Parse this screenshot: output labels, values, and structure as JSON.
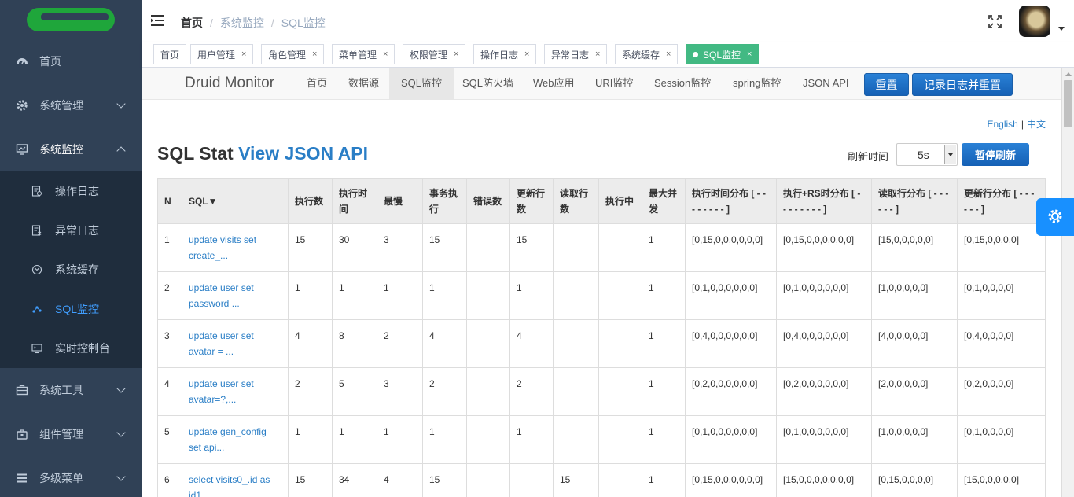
{
  "sidebar": {
    "items": [
      {
        "label": "首页",
        "icon": "dashboard-icon"
      },
      {
        "label": "系统管理",
        "icon": "gear-icon"
      },
      {
        "label": "系统监控",
        "icon": "monitor-icon"
      },
      {
        "label": "系统工具",
        "icon": "toolbox-icon"
      },
      {
        "label": "组件管理",
        "icon": "component-icon"
      },
      {
        "label": "多级菜单",
        "icon": "list-icon"
      }
    ],
    "submenu": [
      {
        "label": "操作日志",
        "icon": "log-icon"
      },
      {
        "label": "异常日志",
        "icon": "error-log-icon"
      },
      {
        "label": "系统缓存",
        "icon": "cache-icon"
      },
      {
        "label": "SQL监控",
        "icon": "sql-icon"
      },
      {
        "label": "实时控制台",
        "icon": "console-icon"
      }
    ],
    "active_color": "#409eff"
  },
  "navbar": {
    "breadcrumb": [
      "首页",
      "系统监控",
      "SQL监控"
    ]
  },
  "tags": [
    {
      "label": "首页"
    },
    {
      "label": "用户管理"
    },
    {
      "label": "角色管理"
    },
    {
      "label": "菜单管理"
    },
    {
      "label": "权限管理"
    },
    {
      "label": "操作日志"
    },
    {
      "label": "异常日志"
    },
    {
      "label": "系统缓存"
    },
    {
      "label": "SQL监控"
    }
  ],
  "druid": {
    "brand": "Druid Monitor",
    "nav": [
      "首页",
      "数据源",
      "SQL监控",
      "SQL防火墙",
      "Web应用",
      "URI监控",
      "Session监控",
      "spring监控",
      "JSON API"
    ],
    "reset_label": "重置",
    "log_reset_label": "记录日志并重置",
    "lang_en": "English",
    "lang_sep": "|",
    "lang_zh": "中文",
    "title": "SQL Stat",
    "title_link": "View JSON API",
    "refresh_label": "刷新时间",
    "refresh_value": "5s",
    "pause_label": "暂停刷新"
  },
  "table": {
    "headers": [
      "N",
      "SQL▼",
      "执行数",
      "执行时间",
      "最慢",
      "事务执行",
      "错误数",
      "更新行数",
      "读取行数",
      "执行中",
      "最大并发",
      "执行时间分布 [ - - - - - - - - ]",
      "执行+RS时分布 [ - - - - - - - - ]",
      "读取行分布 [ - - - - - - ]",
      "更新行分布 [ - - - - - - ]"
    ],
    "rows": [
      [
        "1",
        "update visits set create_...",
        "15",
        "30",
        "3",
        "15",
        "",
        "15",
        "",
        "",
        "1",
        "[0,15,0,0,0,0,0,0]",
        "[0,15,0,0,0,0,0,0]",
        "[15,0,0,0,0,0]",
        "[0,15,0,0,0,0]"
      ],
      [
        "2",
        "update user set password ...",
        "1",
        "1",
        "1",
        "1",
        "",
        "1",
        "",
        "",
        "1",
        "[0,1,0,0,0,0,0,0]",
        "[0,1,0,0,0,0,0,0]",
        "[1,0,0,0,0,0]",
        "[0,1,0,0,0,0]"
      ],
      [
        "3",
        "update user set avatar = ...",
        "4",
        "8",
        "2",
        "4",
        "",
        "4",
        "",
        "",
        "1",
        "[0,4,0,0,0,0,0,0]",
        "[0,4,0,0,0,0,0,0]",
        "[4,0,0,0,0,0]",
        "[0,4,0,0,0,0]"
      ],
      [
        "4",
        "update user set avatar=?,...",
        "2",
        "5",
        "3",
        "2",
        "",
        "2",
        "",
        "",
        "1",
        "[0,2,0,0,0,0,0,0]",
        "[0,2,0,0,0,0,0,0]",
        "[2,0,0,0,0,0]",
        "[0,2,0,0,0,0]"
      ],
      [
        "5",
        "update gen_config set api...",
        "1",
        "1",
        "1",
        "1",
        "",
        "1",
        "",
        "",
        "1",
        "[0,1,0,0,0,0,0,0]",
        "[0,1,0,0,0,0,0,0]",
        "[1,0,0,0,0,0]",
        "[0,1,0,0,0,0]"
      ],
      [
        "6",
        "select visits0_.id as id1...",
        "15",
        "34",
        "4",
        "15",
        "",
        "",
        "15",
        "",
        "1",
        "[0,15,0,0,0,0,0,0]",
        "[15,0,0,0,0,0,0,0]",
        "[0,15,0,0,0,0]",
        "[15,0,0,0,0,0]"
      ]
    ]
  }
}
